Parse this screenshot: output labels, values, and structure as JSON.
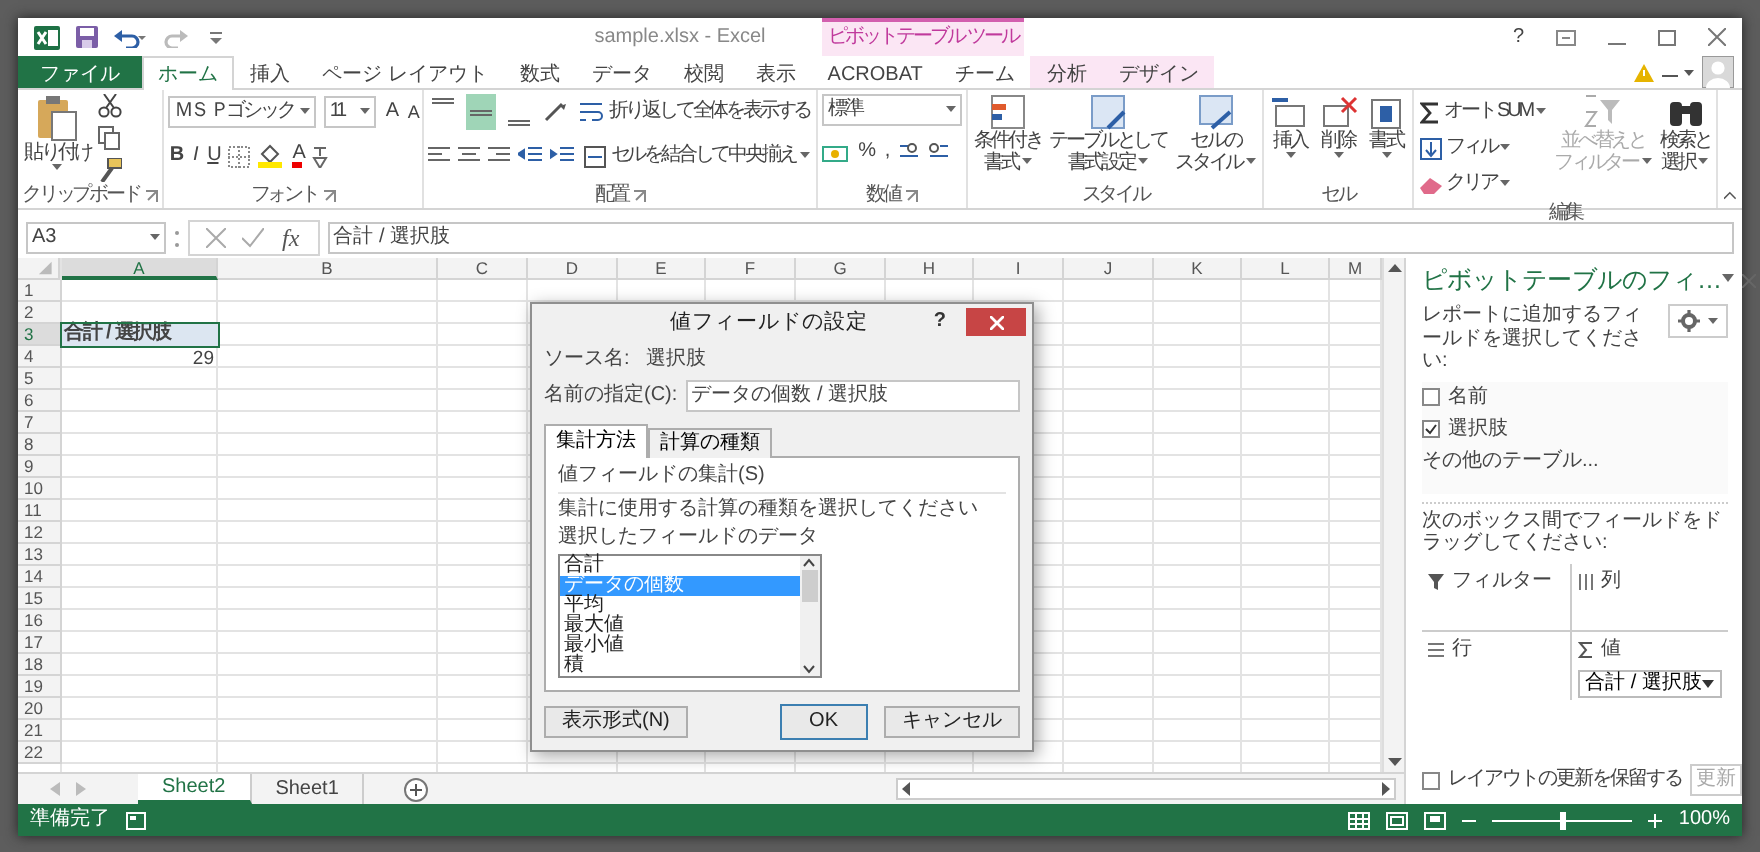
{
  "title_bar": {
    "title": "sample.xlsx - Excel",
    "context_group": "ピボットテーブル ツール",
    "help": "?"
  },
  "tabs": [
    {
      "label": "ファイル",
      "kind": "file",
      "selected": false
    },
    {
      "label": "ホーム",
      "kind": "normal",
      "selected": true
    },
    {
      "label": "挿入",
      "kind": "normal",
      "selected": false
    },
    {
      "label": "ページ レイアウト",
      "kind": "normal",
      "selected": false
    },
    {
      "label": "数式",
      "kind": "normal",
      "selected": false
    },
    {
      "label": "データ",
      "kind": "normal",
      "selected": false
    },
    {
      "label": "校閲",
      "kind": "normal",
      "selected": false
    },
    {
      "label": "表示",
      "kind": "normal",
      "selected": false
    },
    {
      "label": "ACROBAT",
      "kind": "normal",
      "selected": false
    },
    {
      "label": "チーム",
      "kind": "normal",
      "selected": false
    },
    {
      "label": "分析",
      "kind": "context",
      "selected": false
    },
    {
      "label": "デザイン",
      "kind": "context",
      "selected": false
    }
  ],
  "ribbon": {
    "clipboard": {
      "label": "クリップボード",
      "paste": "貼り付け"
    },
    "font": {
      "label": "フォント",
      "font_name": "ＭＳ Ｐゴシック",
      "font_size": "11",
      "grow": "A",
      "shrink": "A",
      "bold": "B",
      "italic": "I",
      "underline": "U",
      "font_color": "A"
    },
    "alignment": {
      "label": "配置",
      "vertical": [
        {
          "selected": false
        },
        {
          "selected": true
        },
        {
          "selected": false
        }
      ],
      "wrap_text": "折り返して全体を表示する",
      "merge_center": "セルを結合して中央揃え"
    },
    "number": {
      "label": "数値",
      "format": "標準",
      "percent": "%",
      "comma": ","
    },
    "styles": {
      "label": "スタイル",
      "buttons": [
        {
          "lines": [
            "条件付き",
            "書式"
          ]
        },
        {
          "lines": [
            "テーブルとして",
            "書式設定"
          ]
        },
        {
          "lines": [
            "セルの",
            "スタイル"
          ]
        }
      ]
    },
    "cells": {
      "label": "セル",
      "buttons": [
        "挿入",
        "削除",
        "書式"
      ]
    },
    "editing": {
      "label": "編集",
      "autosum": "オート SUM",
      "fill": "フィル",
      "clear": "クリア",
      "sort": {
        "lines": [
          "並べ替えと",
          "フィルター"
        ],
        "disabled": true
      },
      "find": {
        "lines": [
          "検索と",
          "選択"
        ],
        "disabled": false
      }
    }
  },
  "formula_bar": {
    "name_box": "A3",
    "fx": "fx",
    "formula": "合計 / 選択肢"
  },
  "sheet": {
    "columns": [
      {
        "label": "A",
        "selected": true
      },
      {
        "label": "B",
        "selected": false
      },
      {
        "label": "C",
        "selected": false
      },
      {
        "label": "D",
        "selected": false
      },
      {
        "label": "E",
        "selected": false
      },
      {
        "label": "F",
        "selected": false
      },
      {
        "label": "G",
        "selected": false
      },
      {
        "label": "H",
        "selected": false
      },
      {
        "label": "I",
        "selected": false
      },
      {
        "label": "J",
        "selected": false
      },
      {
        "label": "K",
        "selected": false
      },
      {
        "label": "L",
        "selected": false
      },
      {
        "label": "M",
        "selected": false
      }
    ],
    "rows": [
      {
        "number": "1",
        "selected": false
      },
      {
        "number": "2",
        "selected": false
      },
      {
        "number": "3",
        "selected": true,
        "cells": [
          {
            "text": "合計 / 選択肢",
            "kind": "header",
            "selected": true
          }
        ]
      },
      {
        "number": "4",
        "selected": false,
        "cells": [
          {
            "text": "29",
            "kind": "number",
            "selected": false
          }
        ]
      },
      {
        "number": "5",
        "selected": false
      },
      {
        "number": "6",
        "selected": false
      },
      {
        "number": "7",
        "selected": false
      },
      {
        "number": "8",
        "selected": false
      },
      {
        "number": "9",
        "selected": false
      },
      {
        "number": "10",
        "selected": false
      },
      {
        "number": "11",
        "selected": false
      },
      {
        "number": "12",
        "selected": false
      },
      {
        "number": "13",
        "selected": false
      },
      {
        "number": "14",
        "selected": false
      },
      {
        "number": "15",
        "selected": false
      },
      {
        "number": "16",
        "selected": false
      },
      {
        "number": "17",
        "selected": false
      },
      {
        "number": "18",
        "selected": false
      },
      {
        "number": "19",
        "selected": false
      },
      {
        "number": "20",
        "selected": false
      },
      {
        "number": "21",
        "selected": false
      },
      {
        "number": "22",
        "selected": false
      }
    ]
  },
  "dialog": {
    "title": "値フィールドの設定",
    "help": "?",
    "source_label": "ソース名:",
    "source_value": "選択肢",
    "name_label": "名前の指定(C):",
    "name_value": "データの個数 / 選択肢",
    "tabs": [
      {
        "label": "集計方法",
        "selected": true
      },
      {
        "label": "計算の種類",
        "selected": false
      }
    ],
    "section": "値フィールドの集計(S)",
    "instruction": "集計に使用する計算の種類を選択してください",
    "list_label": "選択したフィールドのデータ",
    "functions": [
      {
        "label": "合計",
        "selected": false
      },
      {
        "label": "データの個数",
        "selected": true
      },
      {
        "label": "平均",
        "selected": false
      },
      {
        "label": "最大値",
        "selected": false
      },
      {
        "label": "最小値",
        "selected": false
      },
      {
        "label": "積",
        "selected": false
      }
    ],
    "number_format_button": "表示形式(N)",
    "ok": "OK",
    "cancel": "キャンセル"
  },
  "pivot_pane": {
    "title": "ピボットテーブルのフィ…",
    "subtitle": "レポートに追加するフィールドを選択してください:",
    "fields": [
      {
        "label": "名前",
        "checked": false
      },
      {
        "label": "選択肢",
        "checked": true
      }
    ],
    "more_tables": "その他のテーブル...",
    "drag_hint": "次のボックス間でフィールドをドラッグしてください:",
    "areas": [
      {
        "kind": "filter",
        "label": "フィルター"
      },
      {
        "kind": "columns",
        "label": "列"
      },
      {
        "kind": "rows",
        "label": "行"
      },
      {
        "kind": "values",
        "label": "値",
        "items": [
          "合計 / 選択肢"
        ]
      }
    ],
    "defer": {
      "label": "レイアウトの更新を保留する",
      "checked": false
    },
    "update_button": {
      "label": "更新",
      "disabled": true
    }
  },
  "sheet_tabs": [
    {
      "label": "Sheet2",
      "selected": true
    },
    {
      "label": "Sheet1",
      "selected": false
    }
  ],
  "status_bar": {
    "status": "準備完了",
    "zoom_slider": {
      "level": 0.5
    },
    "zoom": "100%"
  }
}
